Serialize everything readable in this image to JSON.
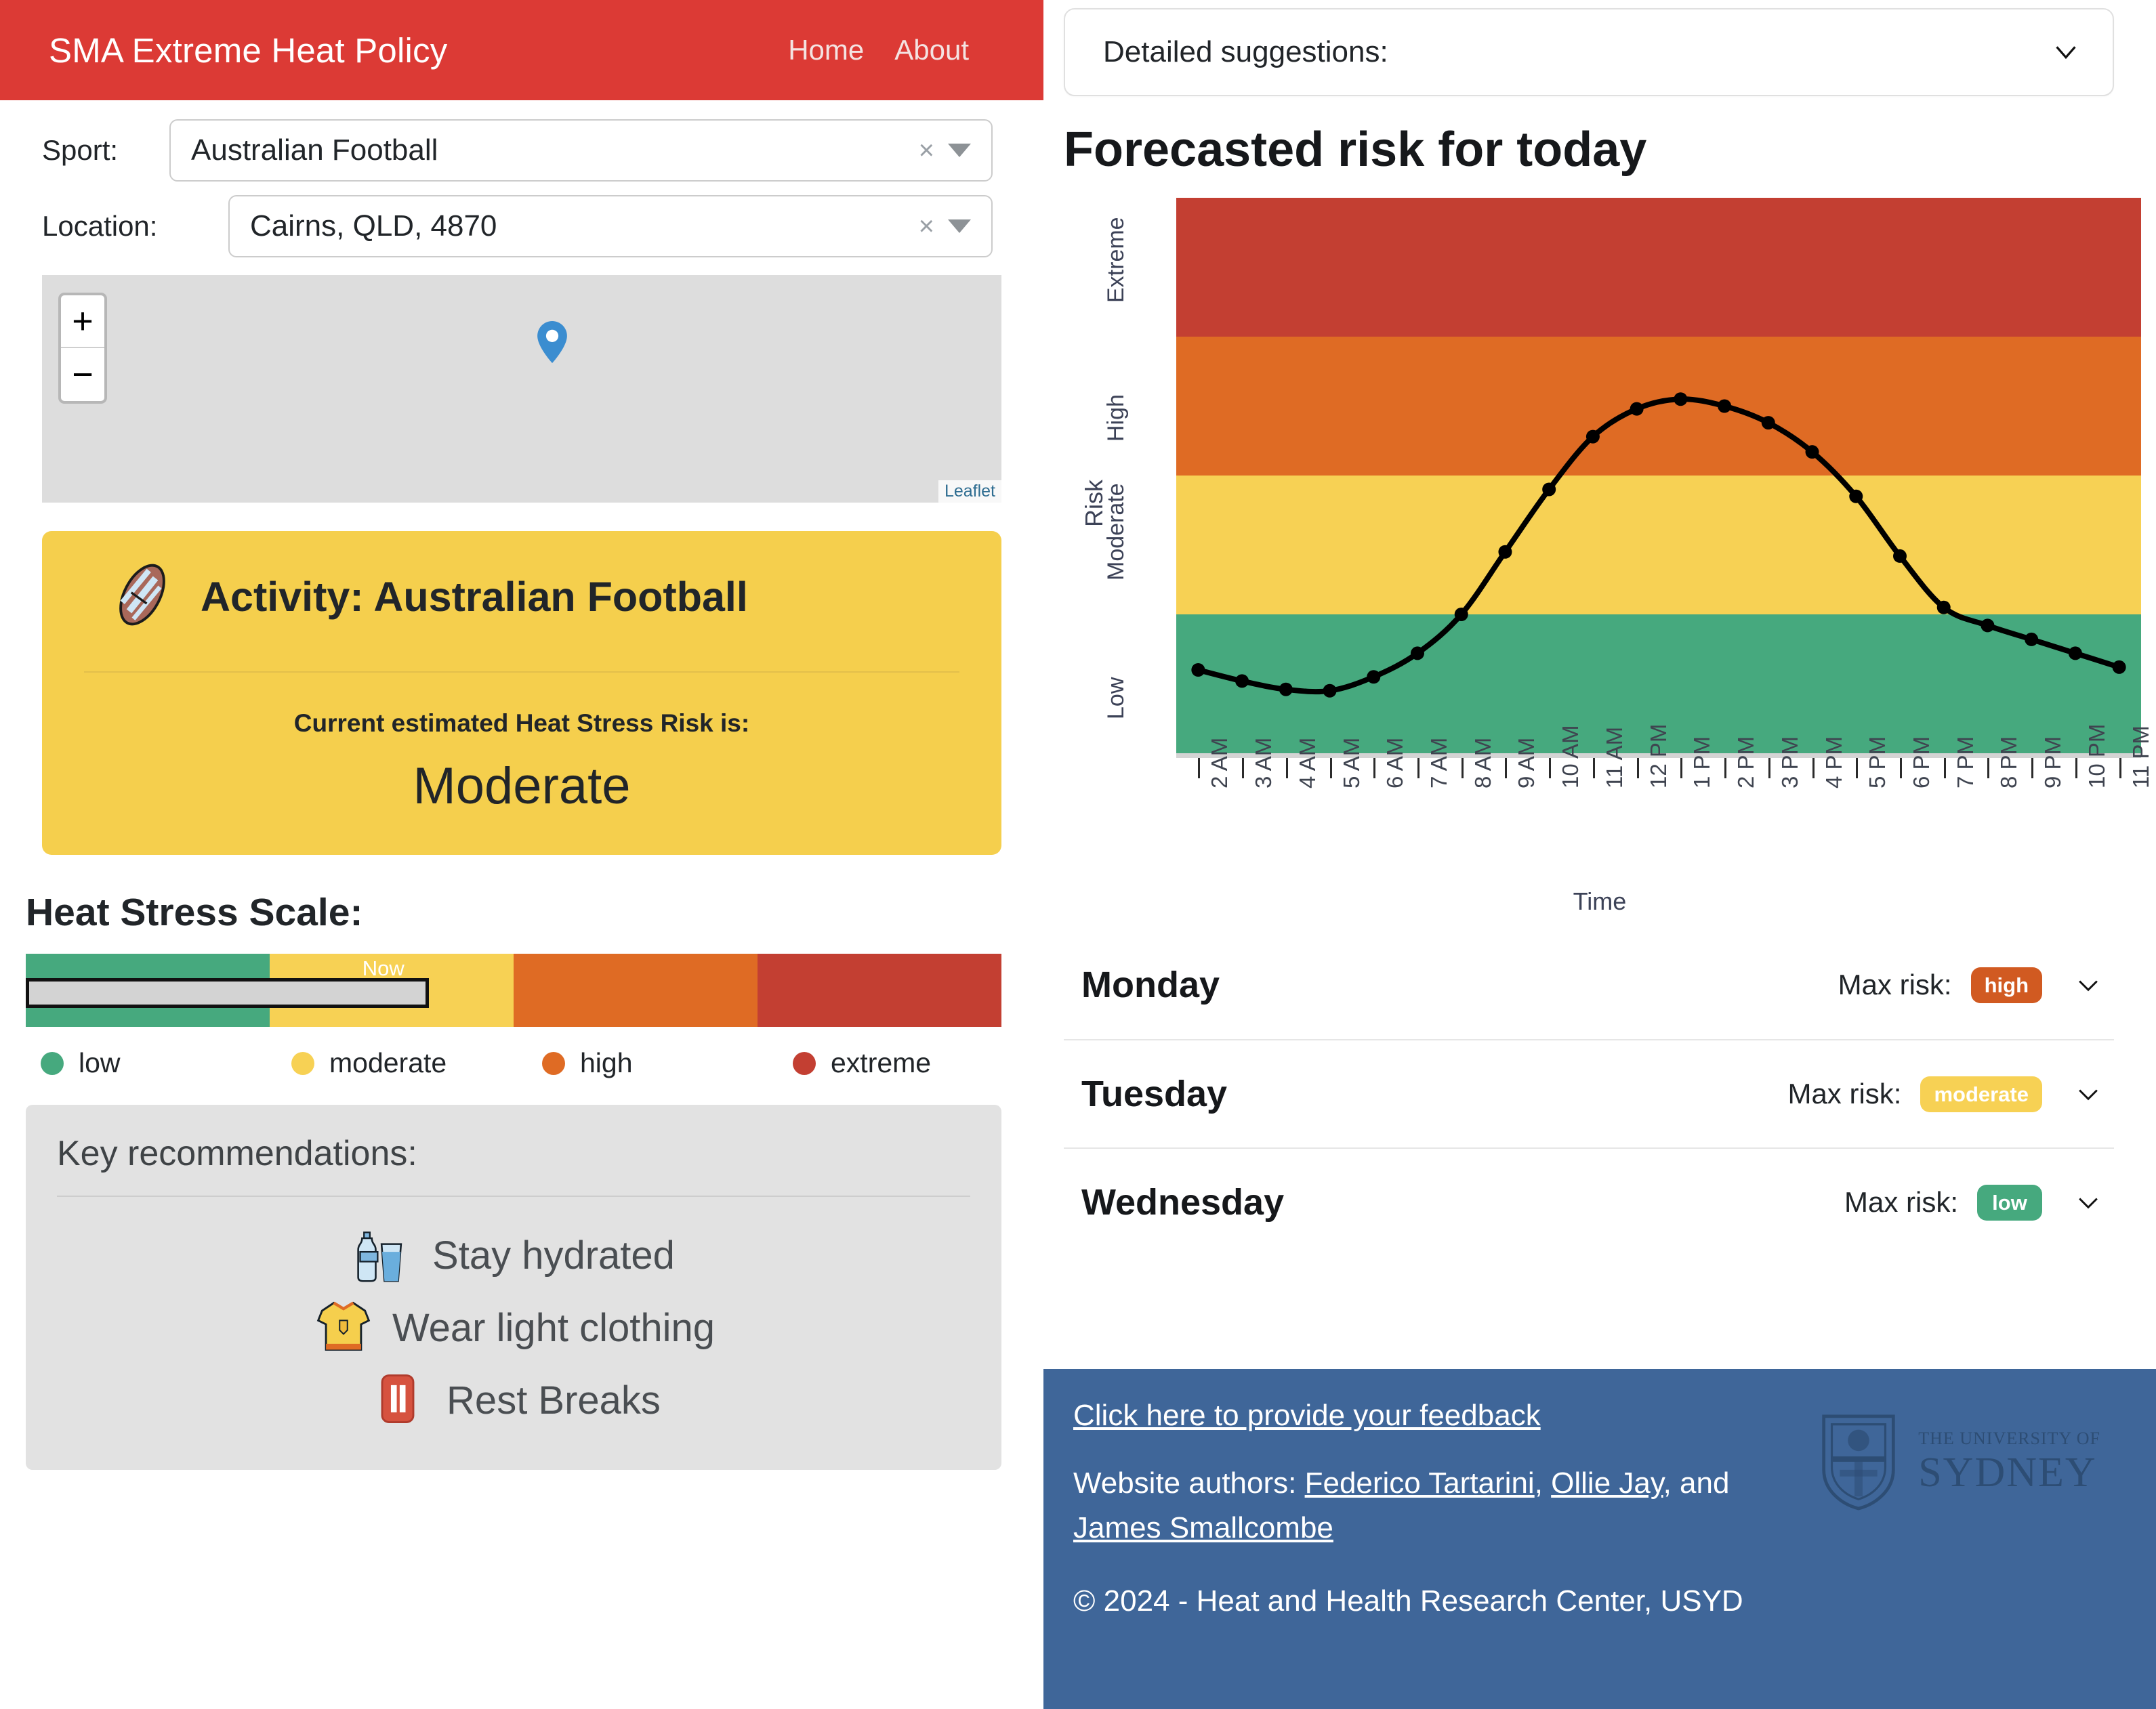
{
  "header": {
    "brand": "SMA Extreme Heat Policy",
    "nav": [
      {
        "label": "Home"
      },
      {
        "label": "About"
      }
    ]
  },
  "filters": {
    "sport": {
      "label": "Sport:",
      "value": "Australian Football",
      "clear_icon": "×"
    },
    "location": {
      "label": "Location:",
      "value": "Cairns, QLD, 4870",
      "clear_icon": "×"
    }
  },
  "map": {
    "zoom_in": "+",
    "zoom_out": "−",
    "attribution": "Leaflet"
  },
  "activity": {
    "title": "Activity: Australian Football",
    "subtitle": "Current estimated Heat Stress Risk is:",
    "risk": "Moderate",
    "card_color": "#f5cf4d"
  },
  "scale": {
    "title": "Heat Stress Scale:",
    "now_label": "Now",
    "now_marker_percent": 41.3,
    "segments": [
      {
        "name": "low",
        "color": "#46a97e",
        "width_percent": 25.0
      },
      {
        "name": "moderate",
        "color": "#f7d154",
        "width_percent": 25.0
      },
      {
        "name": "high",
        "color": "#df6b24",
        "width_percent": 25.0
      },
      {
        "name": "extreme",
        "color": "#c33f32",
        "width_percent": 25.0
      }
    ],
    "legend": [
      {
        "label": "low",
        "color": "#46a97e"
      },
      {
        "label": "moderate",
        "color": "#f7d154"
      },
      {
        "label": "high",
        "color": "#df6b24"
      },
      {
        "label": "extreme",
        "color": "#c33f32"
      }
    ]
  },
  "recommendations": {
    "title": "Key recommendations:",
    "items": [
      {
        "icon": "water-bottle-icon",
        "label": "Stay hydrated"
      },
      {
        "icon": "tshirt-icon",
        "label": "Wear light clothing"
      },
      {
        "icon": "pause-icon",
        "label": "Rest Breaks"
      }
    ]
  },
  "suggestions": {
    "label": "Detailed suggestions:",
    "chevron": "chevron-down-icon"
  },
  "forecast": {
    "title": "Forecasted risk for today"
  },
  "chart_data": {
    "type": "line",
    "title": "Forecasted risk for today",
    "xlabel": "Time",
    "ylabel": "Risk",
    "grid": false,
    "legend_position": "none",
    "x": [
      "2 AM",
      "3 AM",
      "4 AM",
      "5 AM",
      "6 AM",
      "7 AM",
      "8 AM",
      "9 AM",
      "10 AM",
      "11 AM",
      "12 PM",
      "1 PM",
      "2 PM",
      "3 PM",
      "4 PM",
      "5 PM",
      "6 PM",
      "7 PM",
      "8 PM",
      "9 PM",
      "10 PM",
      "11 PM"
    ],
    "y_categories": [
      "Low",
      "Moderate",
      "High",
      "Extreme"
    ],
    "ylim": [
      0,
      4
    ],
    "values": [
      0.6,
      0.52,
      0.46,
      0.45,
      0.55,
      0.72,
      1.0,
      1.45,
      1.9,
      2.28,
      2.48,
      2.55,
      2.5,
      2.38,
      2.17,
      1.85,
      1.42,
      1.05,
      0.92,
      0.82,
      0.72,
      0.62
    ],
    "bands": [
      {
        "name": "Low",
        "color": "#46a97e",
        "from": 0,
        "to": 1
      },
      {
        "name": "Moderate",
        "color": "#f7d154",
        "from": 1,
        "to": 2
      },
      {
        "name": "High",
        "color": "#df6b24",
        "from": 2,
        "to": 3
      },
      {
        "name": "Extreme",
        "color": "#c33f32",
        "from": 3,
        "to": 4
      }
    ],
    "line_color": "#000000",
    "marker": "circle"
  },
  "days": [
    {
      "name": "Monday",
      "max_risk_label": "Max risk:",
      "badge": "high",
      "badge_color": "#d15a21"
    },
    {
      "name": "Tuesday",
      "max_risk_label": "Max risk:",
      "badge": "moderate",
      "badge_color": "#f7d154"
    },
    {
      "name": "Wednesday",
      "max_risk_label": "Max risk:",
      "badge": "low",
      "badge_color": "#46a97e"
    }
  ],
  "footer": {
    "background": "#3f6699",
    "feedback_link": "Click here to provide your feedback",
    "authors_prefix": "Website authors: ",
    "author1": "Federico Tartarini",
    "author_sep1": ", ",
    "author2": "Ollie Jay",
    "author_sep2": ", and ",
    "author3": "James Smallcombe",
    "copyright": "© 2024 - Heat and Health Research Center, USYD",
    "logo_line1": "THE UNIVERSITY OF",
    "logo_line2": "SYDNEY"
  }
}
